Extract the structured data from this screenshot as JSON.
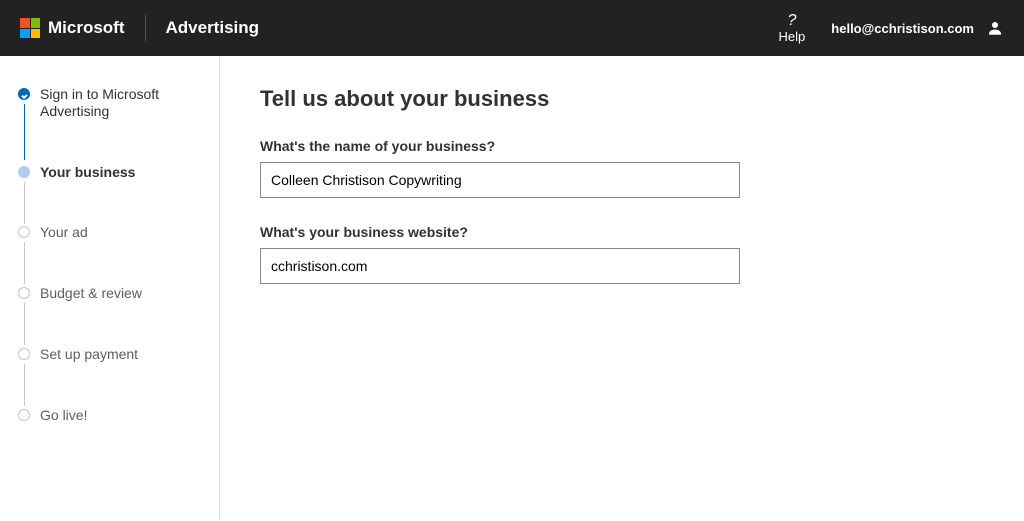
{
  "topbar": {
    "brand": "Microsoft",
    "product": "Advertising",
    "help_label": "Help",
    "user_email": "hello@cchristison.com"
  },
  "steps": [
    {
      "label": "Sign in to Microsoft Advertising"
    },
    {
      "label": "Your business"
    },
    {
      "label": "Your ad"
    },
    {
      "label": "Budget & review"
    },
    {
      "label": "Set up payment"
    },
    {
      "label": "Go live!"
    }
  ],
  "page": {
    "title": "Tell us about your business",
    "name_question": "What's the name of your business?",
    "name_value": "Colleen Christison Copywriting",
    "website_question": "What's your business website?",
    "website_value": "cchristison.com"
  }
}
